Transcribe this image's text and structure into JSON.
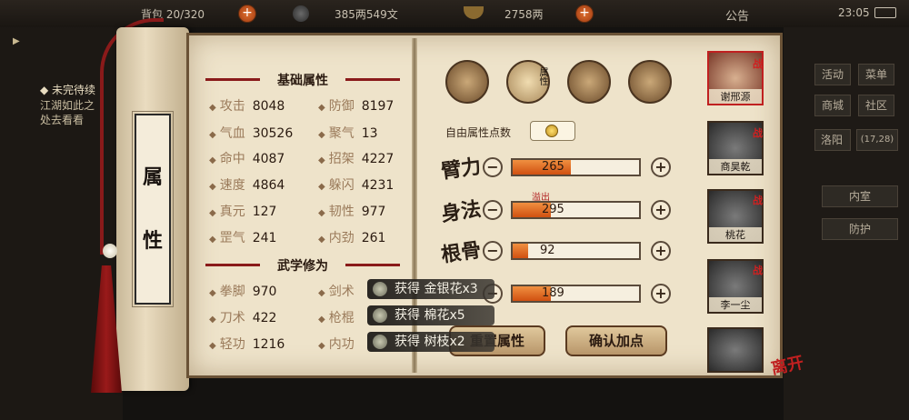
{
  "topbar": {
    "capacity": "背包 20/320",
    "money": "385两549文",
    "silver": "2758两",
    "notice": "公告",
    "time": "23:05"
  },
  "quest": {
    "title": "◆ 未完待续",
    "line1": "江湖如此之",
    "line2": "处去看看"
  },
  "scroll_label": [
    "属",
    "性"
  ],
  "basic": {
    "title": "基础属性",
    "rows": [
      {
        "l_label": "攻击",
        "l_val": "8048",
        "r_label": "防御",
        "r_val": "8197"
      },
      {
        "l_label": "气血",
        "l_val": "30526",
        "r_label": "聚气",
        "r_val": "13"
      },
      {
        "l_label": "命中",
        "l_val": "4087",
        "r_label": "招架",
        "r_val": "4227"
      },
      {
        "l_label": "速度",
        "l_val": "4864",
        "r_label": "躲闪",
        "r_val": "4231"
      },
      {
        "l_label": "真元",
        "l_val": "127",
        "r_label": "韧性",
        "r_val": "977"
      },
      {
        "l_label": "罡气",
        "l_val": "241",
        "r_label": "内劲",
        "r_val": "261"
      }
    ]
  },
  "martial": {
    "title": "武学修为",
    "rows": [
      {
        "l_label": "拳脚",
        "l_val": "970",
        "r_label": "剑术",
        "r_val": ""
      },
      {
        "l_label": "刀术",
        "l_val": "422",
        "r_label": "枪棍",
        "r_val": ""
      },
      {
        "l_label": "轻功",
        "l_val": "1216",
        "r_label": "内功",
        "r_val": ""
      }
    ]
  },
  "tabs": [
    "equip-tab",
    "attribute-tab",
    "bagua-tab",
    "meridian-tab"
  ],
  "tab_attr_label": "属性",
  "free_points_label": "自由属性点数",
  "free_points": "0",
  "stats": [
    {
      "name": "臂力",
      "value": "265",
      "fill": 0.46
    },
    {
      "name": "身法",
      "value": "295",
      "fill": 0.3
    },
    {
      "name": "根骨",
      "value": "92",
      "fill": 0.12
    },
    {
      "name": "",
      "value": "189",
      "fill": 0.3
    }
  ],
  "overflow_text": "溢出",
  "reset_button": "重置属性",
  "confirm_button": "确认加点",
  "toasts": [
    "获得 金银花x3",
    "获得 棉花x5",
    "获得 树枝x2"
  ],
  "party": [
    {
      "name": "谢邢源",
      "badge": "战"
    },
    {
      "name": "商昊乾",
      "badge": "战"
    },
    {
      "name": "桃花",
      "badge": "战"
    },
    {
      "name": "李一尘",
      "badge": "战"
    },
    {
      "name": "",
      "badge": ""
    }
  ],
  "side_menu": {
    "activity": "活动",
    "menu": "菜单",
    "shop": "商城",
    "community": "社区",
    "location": "洛阳",
    "coord": "(17,28)",
    "inner": "内室",
    "protect": "防护"
  },
  "leave_label": "离开",
  "colors": {
    "accent_red": "#8a1a1a",
    "bar_fill": "#e06a20",
    "parchment": "#eee3ca"
  }
}
